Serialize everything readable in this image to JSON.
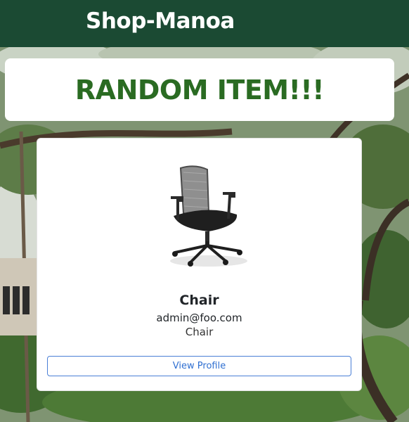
{
  "navbar": {
    "brand": "Shop-Manoa"
  },
  "banner": {
    "title": "RANDOM ITEM!!!"
  },
  "item": {
    "image_icon": "office-chair",
    "name": "Chair",
    "owner": "admin@foo.com",
    "description": "Chair",
    "view_button_label": "View Profile"
  },
  "colors": {
    "navbar": "#1b4a33",
    "title": "#2a6b22",
    "button_border": "#4a7fd6",
    "button_text": "#2f6fd1"
  }
}
